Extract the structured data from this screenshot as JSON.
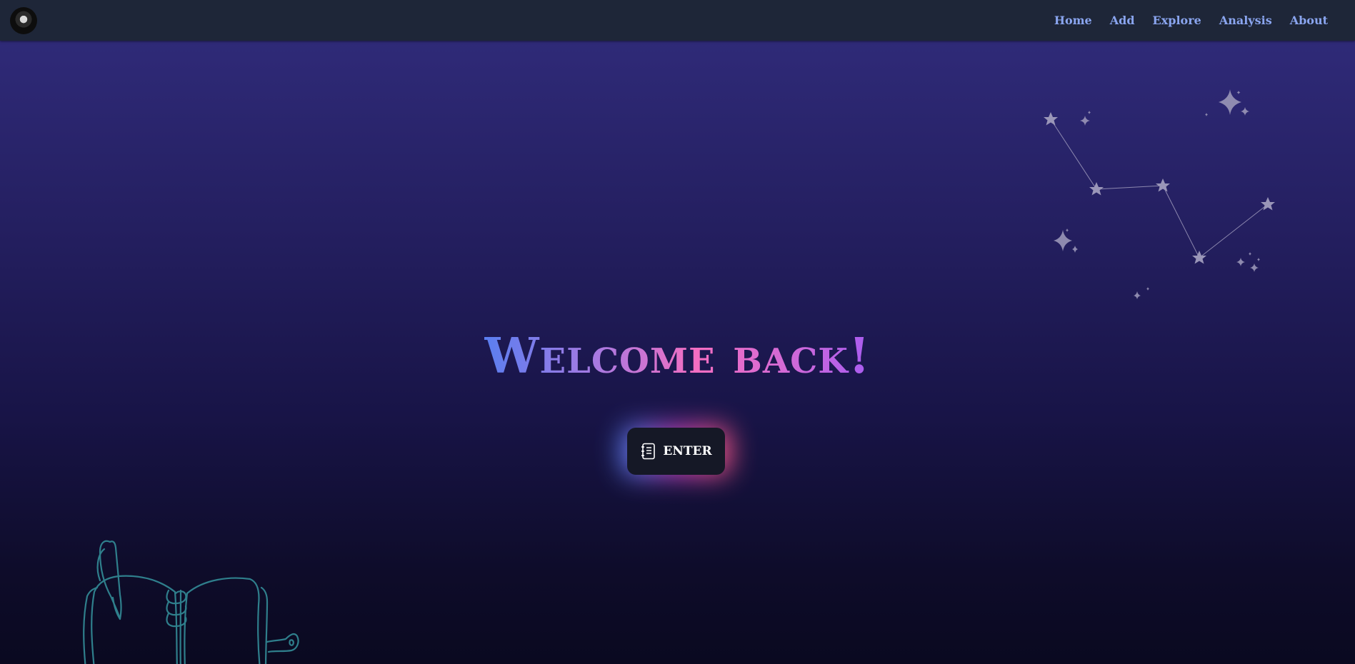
{
  "navbar": {
    "links": [
      {
        "label": "Home"
      },
      {
        "label": "Add"
      },
      {
        "label": "Explore"
      },
      {
        "label": "Analysis"
      },
      {
        "label": "About"
      }
    ]
  },
  "hero": {
    "title": "Welcome back!",
    "enter_button": {
      "label": "ENTER",
      "icon": "notebook-icon"
    }
  },
  "colors": {
    "navbar_bg": "#1e2638",
    "nav_link": "#8aa5ef",
    "hero_top": "#2f2a78",
    "hero_bottom": "#0a0920",
    "title_gradient": [
      "#5a7ef0",
      "#f46ec2",
      "#a85cf0"
    ],
    "button_bg": "#151826",
    "doodle_stroke": "#2f7f8c",
    "star": "#9a96b8"
  }
}
